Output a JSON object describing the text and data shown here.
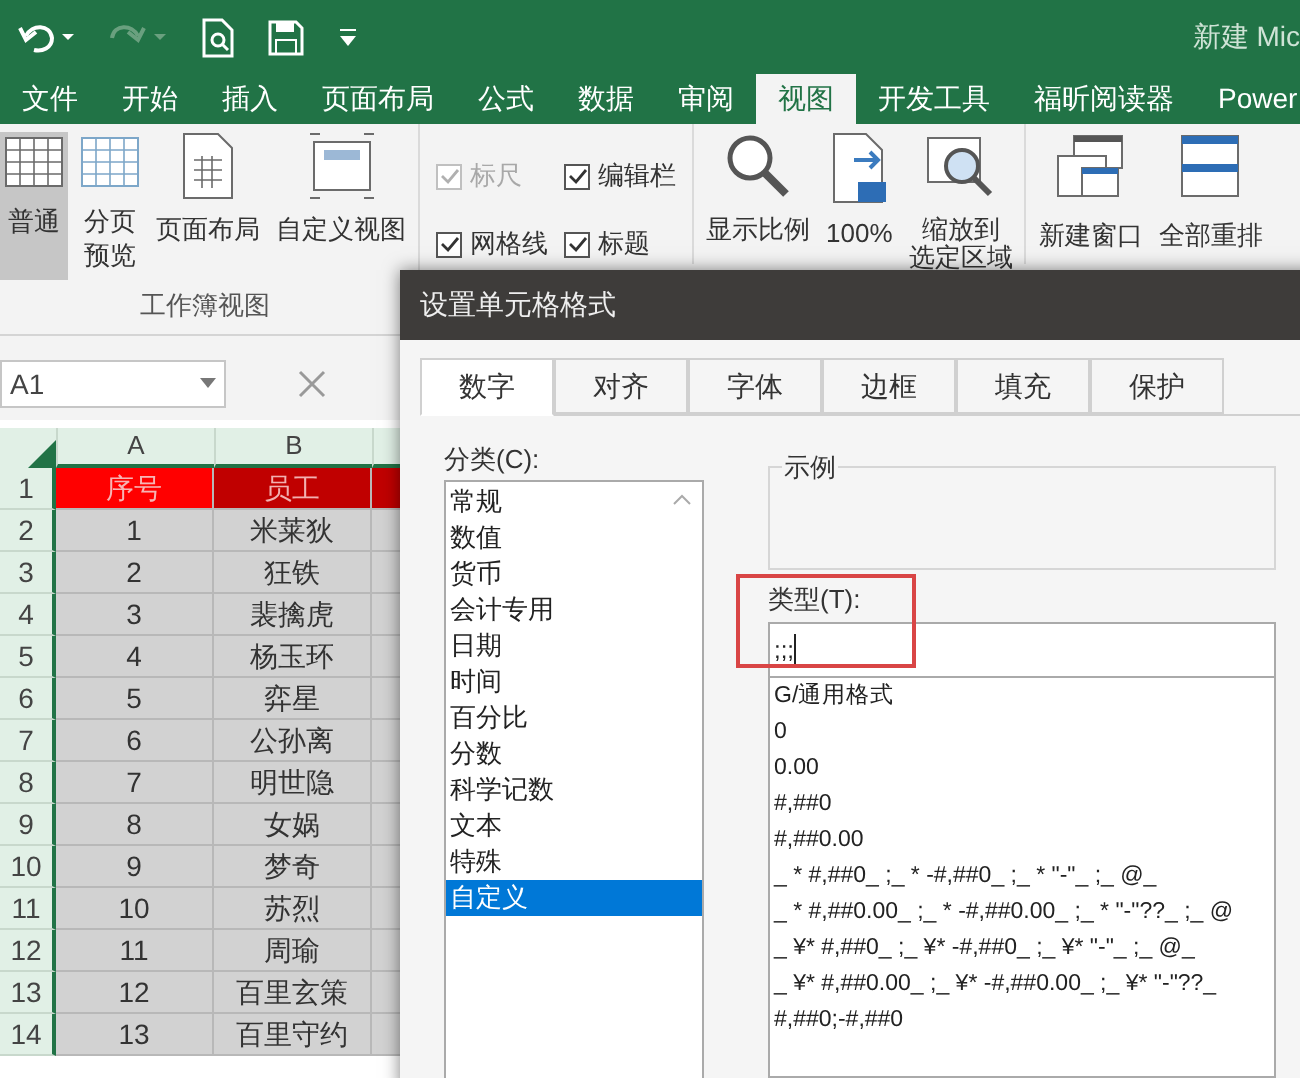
{
  "window": {
    "title": "新建 Mic"
  },
  "ribbon_tabs": [
    {
      "label": "文件",
      "selected": false
    },
    {
      "label": "开始",
      "selected": false
    },
    {
      "label": "插入",
      "selected": false
    },
    {
      "label": "页面布局",
      "selected": false
    },
    {
      "label": "公式",
      "selected": false
    },
    {
      "label": "数据",
      "selected": false
    },
    {
      "label": "审阅",
      "selected": false
    },
    {
      "label": "视图",
      "selected": true
    },
    {
      "label": "开发工具",
      "selected": false
    },
    {
      "label": "福昕阅读器",
      "selected": false
    },
    {
      "label": "Power",
      "selected": false
    }
  ],
  "workbook_views": {
    "label": "工作簿视图",
    "buttons": [
      {
        "lines": [
          "普通"
        ],
        "selected": true,
        "kind": "normal"
      },
      {
        "lines": [
          "分页",
          "预览"
        ],
        "selected": false,
        "kind": "pagebreak"
      },
      {
        "lines": [
          "页面布局"
        ],
        "selected": false,
        "kind": "layout"
      },
      {
        "lines": [
          "自定义视图"
        ],
        "selected": false,
        "kind": "custom"
      }
    ]
  },
  "show_options": [
    {
      "label": "标尺",
      "checked": true,
      "disabled": true
    },
    {
      "label": "编辑栏",
      "checked": true,
      "disabled": false
    },
    {
      "label": "网格线",
      "checked": true,
      "disabled": false
    },
    {
      "label": "标题",
      "checked": true,
      "disabled": false
    }
  ],
  "zoom_buttons": [
    {
      "lines": [
        "显示比例"
      ],
      "kind": "zoom"
    },
    {
      "lines": [
        "100%"
      ],
      "kind": "hundred"
    },
    {
      "lines": [
        "缩放到",
        "选定区域"
      ],
      "kind": "selection"
    }
  ],
  "window_buttons": [
    {
      "lines": [
        "新建窗口"
      ],
      "kind": "newwin"
    },
    {
      "lines": [
        "全部重排"
      ],
      "kind": "arrange"
    }
  ],
  "name_box": {
    "value": "A1"
  },
  "sheet": {
    "columns": [
      "A",
      "B"
    ],
    "rows": [
      {
        "n": "1",
        "a": "序号",
        "b": "员工",
        "header": true
      },
      {
        "n": "2",
        "a": "1",
        "b": "米莱狄",
        "header": false
      },
      {
        "n": "3",
        "a": "2",
        "b": "狂铁",
        "header": false
      },
      {
        "n": "4",
        "a": "3",
        "b": "裴擒虎",
        "header": false
      },
      {
        "n": "5",
        "a": "4",
        "b": "杨玉环",
        "header": false
      },
      {
        "n": "6",
        "a": "5",
        "b": "弈星",
        "header": false
      },
      {
        "n": "7",
        "a": "6",
        "b": "公孙离",
        "header": false
      },
      {
        "n": "8",
        "a": "7",
        "b": "明世隐",
        "header": false
      },
      {
        "n": "9",
        "a": "8",
        "b": "女娲",
        "header": false
      },
      {
        "n": "10",
        "a": "9",
        "b": "梦奇",
        "header": false
      },
      {
        "n": "11",
        "a": "10",
        "b": "苏烈",
        "header": false
      },
      {
        "n": "12",
        "a": "11",
        "b": "周瑜",
        "header": false
      },
      {
        "n": "13",
        "a": "12",
        "b": "百里玄策",
        "header": false
      },
      {
        "n": "14",
        "a": "13",
        "b": "百里守约",
        "header": false
      }
    ]
  },
  "dialog": {
    "title": "设置单元格格式",
    "tabs": [
      {
        "label": "数字",
        "selected": true
      },
      {
        "label": "对齐",
        "selected": false
      },
      {
        "label": "字体",
        "selected": false
      },
      {
        "label": "边框",
        "selected": false
      },
      {
        "label": "填充",
        "selected": false
      },
      {
        "label": "保护",
        "selected": false
      }
    ],
    "category_label": "分类(C):",
    "categories": [
      {
        "label": "常规",
        "selected": false
      },
      {
        "label": "数值",
        "selected": false
      },
      {
        "label": "货币",
        "selected": false
      },
      {
        "label": "会计专用",
        "selected": false
      },
      {
        "label": "日期",
        "selected": false
      },
      {
        "label": "时间",
        "selected": false
      },
      {
        "label": "百分比",
        "selected": false
      },
      {
        "label": "分数",
        "selected": false
      },
      {
        "label": "科学记数",
        "selected": false
      },
      {
        "label": "文本",
        "selected": false
      },
      {
        "label": "特殊",
        "selected": false
      },
      {
        "label": "自定义",
        "selected": true
      }
    ],
    "sample_label": "示例",
    "type_label": "类型(T):",
    "type_value": ";;;",
    "type_list": [
      "G/通用格式",
      "0",
      "0.00",
      "#,##0",
      "#,##0.00",
      "_ * #,##0_ ;_ * -#,##0_ ;_ * \"-\"_ ;_ @_",
      "_ * #,##0.00_ ;_ * -#,##0.00_ ;_ * \"-\"??_ ;_ @",
      "_ ¥* #,##0_ ;_ ¥* -#,##0_ ;_ ¥* \"-\"_ ;_ @_",
      "_ ¥* #,##0.00_ ;_ ¥* -#,##0.00_ ;_ ¥* \"-\"??_",
      "#,##0;-#,##0"
    ]
  }
}
